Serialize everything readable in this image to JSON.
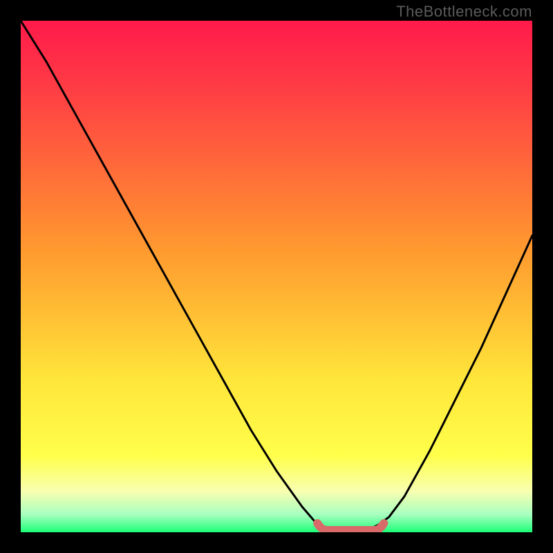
{
  "watermark": "TheBottleneck.com",
  "colors": {
    "black": "#000000",
    "curve": "#000000",
    "marker": "#d86a6a",
    "gradient_top": "#ff1a4a",
    "gradient_red": "#ff3945",
    "gradient_orange": "#ff9a2f",
    "gradient_yellow": "#ffe53a",
    "gradient_yellow2": "#ffff4a",
    "gradient_pale": "#f8ffb0",
    "gradient_mint": "#a8ffc0",
    "gradient_green": "#1dff78"
  },
  "chart_data": {
    "type": "line",
    "title": "",
    "xlabel": "",
    "ylabel": "",
    "xlim": [
      0,
      100
    ],
    "ylim": [
      0,
      100
    ],
    "x": [
      0,
      5,
      10,
      15,
      20,
      25,
      30,
      35,
      40,
      45,
      50,
      55,
      58,
      60,
      62,
      65,
      68,
      70,
      72,
      75,
      80,
      85,
      90,
      95,
      100
    ],
    "y": [
      100,
      92,
      83,
      74,
      65,
      56,
      47,
      38,
      29,
      20,
      12,
      5,
      1.5,
      0.5,
      0.3,
      0.3,
      0.5,
      1.5,
      3,
      7,
      16,
      26,
      36,
      47,
      58
    ],
    "plateau": {
      "x_start": 58,
      "x_end": 71,
      "y": 0.4
    },
    "legend": [],
    "annotations": []
  }
}
